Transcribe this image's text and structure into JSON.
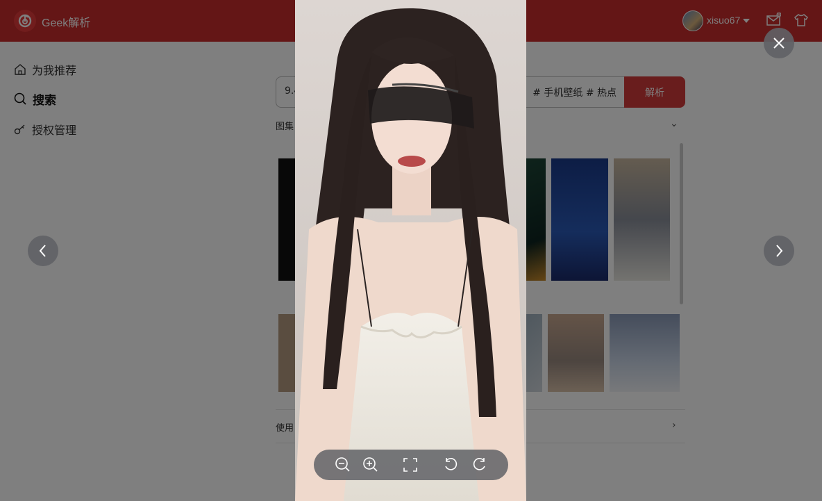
{
  "app": {
    "title": "Geek解析"
  },
  "user": {
    "name": "xisuo67"
  },
  "sidebar": {
    "items": [
      {
        "label": "为我推荐"
      },
      {
        "label": "搜索"
      },
      {
        "label": "授权管理"
      }
    ]
  },
  "search": {
    "value_start": "9.4",
    "value_end": "# 手机壁纸 # 热点",
    "button_label": "解析"
  },
  "results": {
    "section_label": "图集",
    "usage_label": "使用"
  },
  "viewer": {
    "toolbar": [
      "zoom-out",
      "zoom-in",
      "fullscreen",
      "rotate-left",
      "rotate-right"
    ]
  },
  "colors": {
    "brand": "#c82c2c",
    "accent": "#d33a3a",
    "overlay": "rgba(0,0,0,0.5)"
  }
}
